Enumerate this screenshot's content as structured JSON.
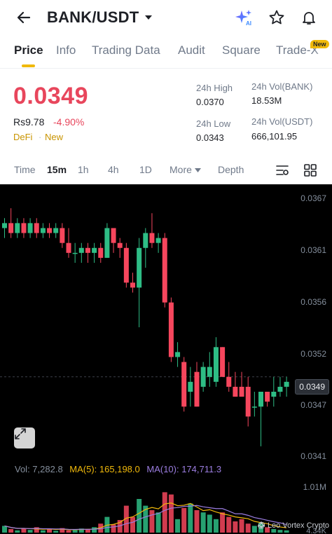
{
  "header": {
    "pair": "BANK/USDT"
  },
  "tabs": [
    {
      "label": "Price"
    },
    {
      "label": "Info"
    },
    {
      "label": "Trading Data"
    },
    {
      "label": "Audit"
    },
    {
      "label": "Square"
    },
    {
      "label": "Trade-X"
    }
  ],
  "badge_new": "New",
  "price": {
    "last": "0.0349",
    "fiat": "Rs9.78",
    "change": "-4.90%",
    "tag1": "DeFi",
    "tag2": "New"
  },
  "stats": {
    "high_label": "24h High",
    "high_value": "0.0370",
    "low_label": "24h Low",
    "low_value": "0.0343",
    "vol_base_label": "24h Vol(BANK)",
    "vol_base_value": "18.53M",
    "vol_quote_label": "24h Vol(USDT)",
    "vol_quote_value": "666,101.95"
  },
  "intervals": {
    "time": "Time",
    "m15": "15m",
    "h1": "1h",
    "h4": "4h",
    "d1": "1D",
    "more": "More",
    "depth": "Depth"
  },
  "chart": {
    "y_labels": [
      "0.0367",
      "0.0361",
      "0.0356",
      "0.0352",
      "0.0347",
      "0.0341"
    ],
    "current_price": "0.0349",
    "vol_label": "Vol: 7,282.8",
    "ma5_label": "MA(5): 165,198.0",
    "ma10_label": "MA(10): 174,711.3",
    "vol_max": "1.01M",
    "vol_min": "4.34K",
    "watermark": "@ Leo Vortex Crypto",
    "colors": {
      "up": "#2ebd85",
      "down": "#f6465d",
      "ma5": "#f0b90b",
      "ma10": "#9b7de0",
      "vol_label": "#848e9c"
    }
  },
  "chart_data": {
    "type": "candlestick",
    "y_axis_ticks": [
      0.0367,
      0.0361,
      0.0356,
      0.0352,
      0.0347,
      0.0341
    ],
    "candles": [
      {
        "o": 0.0364,
        "h": 0.0365,
        "l": 0.0363,
        "c": 0.03645
      },
      {
        "o": 0.03645,
        "h": 0.0366,
        "l": 0.0363,
        "c": 0.03635
      },
      {
        "o": 0.03635,
        "h": 0.0365,
        "l": 0.0363,
        "c": 0.03645
      },
      {
        "o": 0.03645,
        "h": 0.0365,
        "l": 0.0363,
        "c": 0.03635
      },
      {
        "o": 0.03635,
        "h": 0.0365,
        "l": 0.0363,
        "c": 0.03645
      },
      {
        "o": 0.03645,
        "h": 0.0365,
        "l": 0.0363,
        "c": 0.03635
      },
      {
        "o": 0.03635,
        "h": 0.03645,
        "l": 0.0363,
        "c": 0.0364
      },
      {
        "o": 0.0364,
        "h": 0.03645,
        "l": 0.0363,
        "c": 0.03635
      },
      {
        "o": 0.03635,
        "h": 0.03645,
        "l": 0.0363,
        "c": 0.0364
      },
      {
        "o": 0.0364,
        "h": 0.03645,
        "l": 0.0362,
        "c": 0.03625
      },
      {
        "o": 0.03625,
        "h": 0.0364,
        "l": 0.0361,
        "c": 0.03615
      },
      {
        "o": 0.03615,
        "h": 0.03625,
        "l": 0.03605,
        "c": 0.03615
      },
      {
        "o": 0.03615,
        "h": 0.03625,
        "l": 0.03605,
        "c": 0.0362
      },
      {
        "o": 0.0362,
        "h": 0.03625,
        "l": 0.03605,
        "c": 0.03615
      },
      {
        "o": 0.03615,
        "h": 0.03625,
        "l": 0.03605,
        "c": 0.0362
      },
      {
        "o": 0.0362,
        "h": 0.03625,
        "l": 0.03605,
        "c": 0.0361
      },
      {
        "o": 0.0361,
        "h": 0.03645,
        "l": 0.0361,
        "c": 0.0364
      },
      {
        "o": 0.0364,
        "h": 0.0364,
        "l": 0.03615,
        "c": 0.03625
      },
      {
        "o": 0.03625,
        "h": 0.0363,
        "l": 0.0361,
        "c": 0.0362
      },
      {
        "o": 0.0362,
        "h": 0.03625,
        "l": 0.0358,
        "c": 0.03585
      },
      {
        "o": 0.03585,
        "h": 0.03595,
        "l": 0.03575,
        "c": 0.0358
      },
      {
        "o": 0.0358,
        "h": 0.0363,
        "l": 0.0354,
        "c": 0.0362
      },
      {
        "o": 0.0362,
        "h": 0.0364,
        "l": 0.036,
        "c": 0.03635
      },
      {
        "o": 0.03635,
        "h": 0.03655,
        "l": 0.0362,
        "c": 0.03625
      },
      {
        "o": 0.03625,
        "h": 0.03635,
        "l": 0.03615,
        "c": 0.0363
      },
      {
        "o": 0.0363,
        "h": 0.03635,
        "l": 0.0356,
        "c": 0.03565
      },
      {
        "o": 0.03565,
        "h": 0.0357,
        "l": 0.03505,
        "c": 0.0351
      },
      {
        "o": 0.0351,
        "h": 0.03525,
        "l": 0.035,
        "c": 0.03515
      },
      {
        "o": 0.03505,
        "h": 0.0351,
        "l": 0.03455,
        "c": 0.0346
      },
      {
        "o": 0.03475,
        "h": 0.035,
        "l": 0.0346,
        "c": 0.03485
      },
      {
        "o": 0.03495,
        "h": 0.03505,
        "l": 0.0346,
        "c": 0.0346
      },
      {
        "o": 0.0348,
        "h": 0.03505,
        "l": 0.03475,
        "c": 0.035
      },
      {
        "o": 0.0349,
        "h": 0.03515,
        "l": 0.0348,
        "c": 0.035
      },
      {
        "o": 0.03485,
        "h": 0.0353,
        "l": 0.0348,
        "c": 0.0352
      },
      {
        "o": 0.0352,
        "h": 0.0352,
        "l": 0.0349,
        "c": 0.0349
      },
      {
        "o": 0.0349,
        "h": 0.03505,
        "l": 0.03475,
        "c": 0.0348
      },
      {
        "o": 0.0348,
        "h": 0.03495,
        "l": 0.0347,
        "c": 0.0347
      },
      {
        "o": 0.0348,
        "h": 0.03495,
        "l": 0.0347,
        "c": 0.0347
      },
      {
        "o": 0.0348,
        "h": 0.0349,
        "l": 0.0344,
        "c": 0.0345
      },
      {
        "o": 0.0346,
        "h": 0.03475,
        "l": 0.0345,
        "c": 0.0346
      },
      {
        "o": 0.0346,
        "h": 0.03475,
        "l": 0.0342,
        "c": 0.03475
      },
      {
        "o": 0.03475,
        "h": 0.03475,
        "l": 0.0346,
        "c": 0.03465
      },
      {
        "o": 0.0347,
        "h": 0.0349,
        "l": 0.0346,
        "c": 0.03475
      },
      {
        "o": 0.03475,
        "h": 0.0349,
        "l": 0.0347,
        "c": 0.0348
      },
      {
        "o": 0.0348,
        "h": 0.0349,
        "l": 0.0347,
        "c": 0.03485
      }
    ]
  }
}
